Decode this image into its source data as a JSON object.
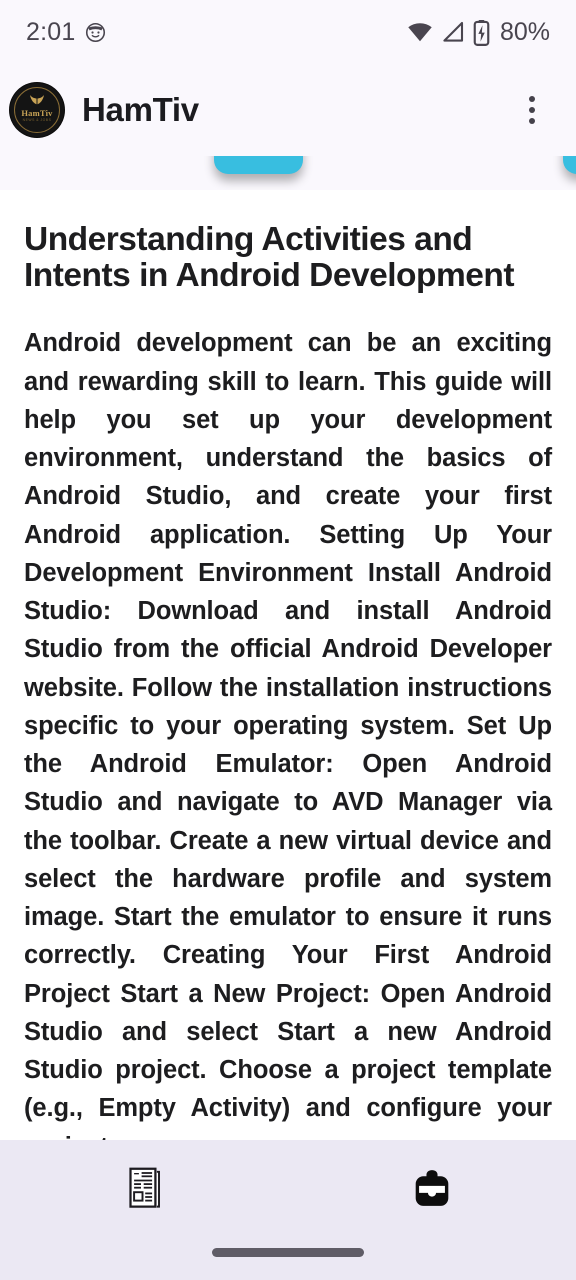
{
  "theme": {
    "accent_cyan": "#38bee0",
    "header_bg": "#faf8fd",
    "bottom_bar_bg": "#ebe8f3",
    "content_bg": "#ffffff",
    "text_primary": "#1d1d1f",
    "status_icon": "#49454f",
    "logo_gold": "#c8a356"
  },
  "statusbar": {
    "time": "2:01",
    "notification_icon": "smiley-face-icon",
    "wifi_icon": "wifi-icon",
    "signal_icon": "cell-signal-icon",
    "battery_icon": "battery-charging-icon",
    "battery_percent": "80%"
  },
  "appbar": {
    "logo": {
      "name": "hamtiv-logo",
      "brand_text": "HamTiv",
      "sub_text": "NEWS & JOBS",
      "crest_icon": "crown-crest-icon"
    },
    "title": "HamTiv",
    "overflow_icon": "more-vertical-icon"
  },
  "carousel": {
    "cards": [
      {
        "name": "promo-card-1",
        "color": "#38bee0"
      },
      {
        "name": "promo-card-2",
        "color": "#38bee0"
      }
    ]
  },
  "article": {
    "title": "Understanding Activities and Intents in Android Development",
    "body": "Android development can be an exciting and rewarding skill to learn.  This guide will help you set up your development environment, understand the basics of Android Studio, and create your first Android application.  Setting Up Your Development Environment  Install Android Studio:  Download and install Android Studio from the official Android Developer website.  Follow the installation instructions specific to your operating system.  Set Up the Android Emulator:  Open Android Studio and navigate to AVD Manager via the toolbar. Create a new virtual device and select the hardware profile and system image. Start the emulator to ensure it runs correctly.  Creating Your First Android Project  Start a New Project: Open Android Studio and select Start a new Android Studio project. Choose a project template (e.g., Empty Activity) and configure your project."
  },
  "bottomnav": {
    "items": [
      {
        "name": "nav-news",
        "icon": "news-article-icon",
        "label": ""
      },
      {
        "name": "nav-jobs",
        "icon": "briefcase-icon",
        "label": ""
      }
    ]
  },
  "gesture_bar": {
    "name": "home-indicator"
  }
}
